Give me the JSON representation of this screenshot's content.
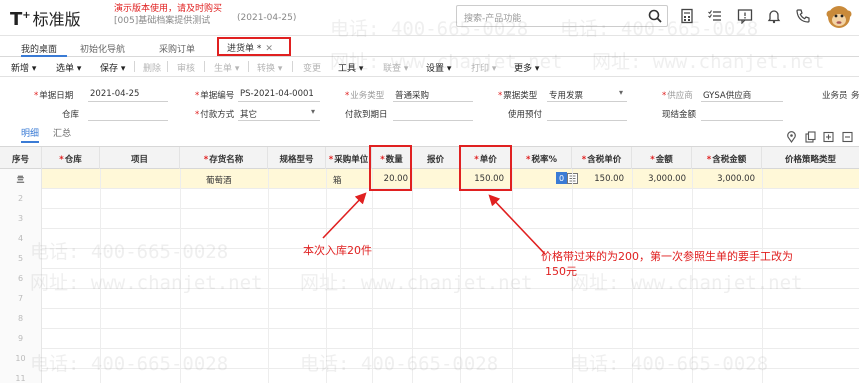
{
  "header": {
    "logo_main": "T",
    "logo_sup": "+",
    "logo_cn": "标准版",
    "demo_note": "演示版本使用，请及时购买",
    "company": "[005]基础档案提供测试",
    "date": "(2021-04-25)",
    "search_placeholder": "搜索-产品功能"
  },
  "tabs": [
    {
      "label": "我的桌面"
    },
    {
      "label": "初始化导航"
    },
    {
      "label": "采购订单"
    },
    {
      "label": "进货单 *",
      "close": "✕"
    }
  ],
  "toolbar": {
    "new": "新增",
    "select": "选单",
    "save": "保存",
    "delete": "删除",
    "audit": "审核",
    "gen": "生单",
    "convert": "转换",
    "change": "变更",
    "tools": "工具",
    "linkquery": "联查",
    "settings": "设置",
    "print": "打印",
    "more": "更多"
  },
  "form": {
    "doc_date_label": "单据日期",
    "doc_date": "2021-04-25",
    "doc_no_label": "单据编号",
    "doc_no": "PS-2021-04-0001",
    "biz_type_label": "业务类型",
    "biz_type": "普通采购",
    "invoice_type_label": "票据类型",
    "invoice_type": "专用发票",
    "supplier_label": "供应商",
    "supplier": "GYSA供应商",
    "salesman_label": "业务员",
    "salesman": "务",
    "warehouse_label": "仓库",
    "pay_method_label": "付款方式",
    "pay_method": "其它",
    "pay_due_label": "付款到期日",
    "prepay_label": "使用预付",
    "cash_label": "现结金额"
  },
  "subtabs": {
    "detail": "明细",
    "summary": "汇总"
  },
  "grid": {
    "headers": {
      "rowno": "序号",
      "warehouse": "仓库",
      "project": "项目",
      "item_name": "存货名称",
      "spec": "规格型号",
      "unit": "采购单位",
      "qty": "数量",
      "price_ref": "报价",
      "price": "单价",
      "tax_rate": "税率%",
      "tax_price": "含税单价",
      "amount": "金额",
      "tax_amount": "含税金额",
      "price_strategy": "价格策略类型"
    },
    "row1": {
      "rowno": "亖",
      "item_name": "葡萄酒",
      "unit": "箱",
      "qty": "20.00",
      "price": "150.00",
      "tax_rate": "0",
      "tax_price": "150.00",
      "amount": "3,000.00",
      "tax_amount": "3,000.00"
    },
    "row_numbers": [
      "2",
      "3",
      "4",
      "5",
      "6",
      "7",
      "8",
      "9",
      "10",
      "11"
    ]
  },
  "annotations": {
    "qty_note": "本次入库20件",
    "price_note_l1": "价格带过来的为200，第一次参照生单的要手工改为",
    "price_note_l2": "150元"
  },
  "watermark": {
    "phone": "电话: 400-665-0028",
    "site": "网址: www.chanjet.net"
  },
  "colors": {
    "accent": "#3a7bd5",
    "annotation_red": "#e02020",
    "row_highlight": "#fff8d8"
  }
}
